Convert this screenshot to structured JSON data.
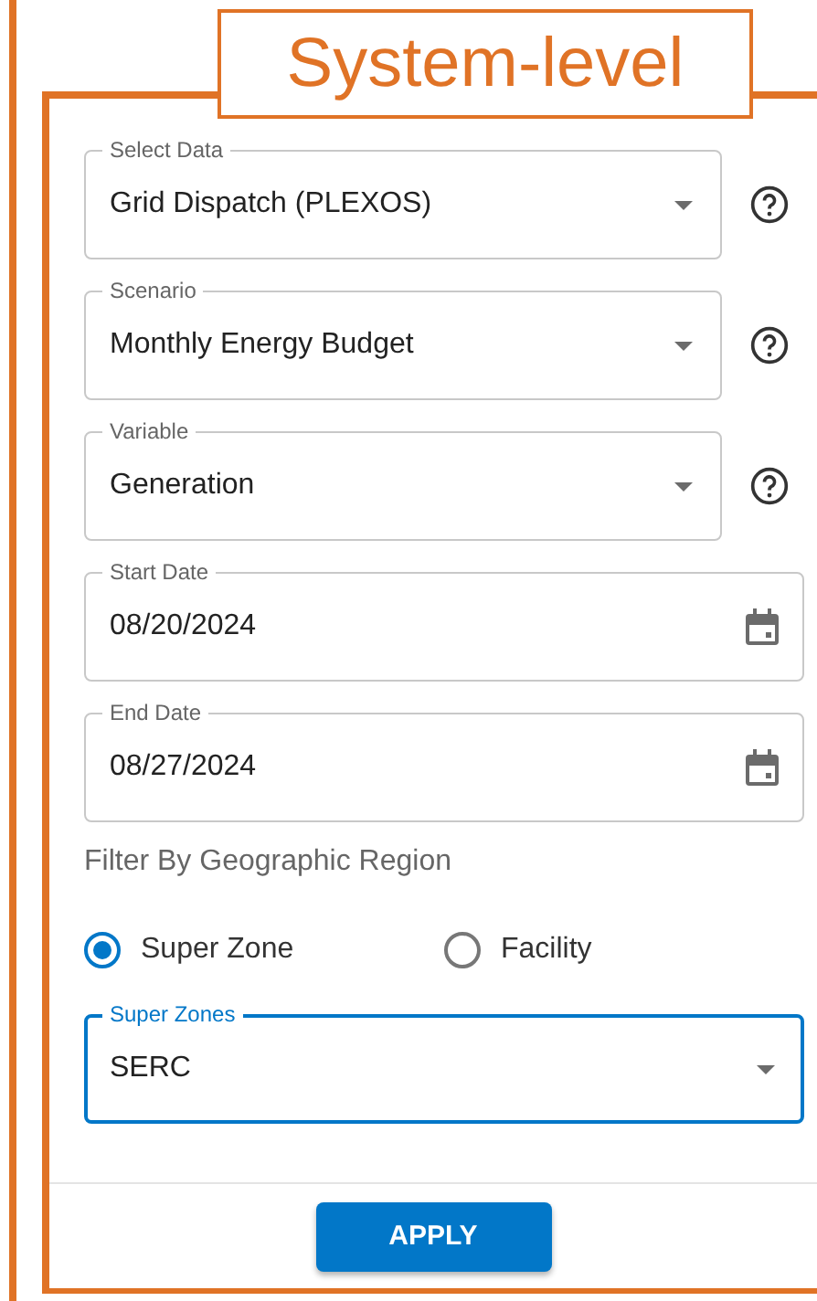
{
  "callout": {
    "title": "System-level"
  },
  "fields": [
    {
      "kind": "select",
      "label": "Select Data",
      "value": "Grid Dispatch (PLEXOS)",
      "has_help": true
    },
    {
      "kind": "select",
      "label": "Scenario",
      "value": "Monthly Energy Budget",
      "has_help": true
    },
    {
      "kind": "select",
      "label": "Variable",
      "value": "Generation",
      "has_help": true
    },
    {
      "kind": "date",
      "label": "Start Date",
      "value": "08/20/2024",
      "has_help": false
    },
    {
      "kind": "date",
      "label": "End Date",
      "value": "08/27/2024",
      "has_help": false
    }
  ],
  "filter": {
    "heading": "Filter By Geographic Region",
    "options": [
      {
        "label": "Super Zone",
        "selected": true
      },
      {
        "label": "Facility",
        "selected": false
      }
    ]
  },
  "region_select": {
    "label": "Super Zones",
    "value": "SERC",
    "focused": true
  },
  "apply_button": "APPLY"
}
